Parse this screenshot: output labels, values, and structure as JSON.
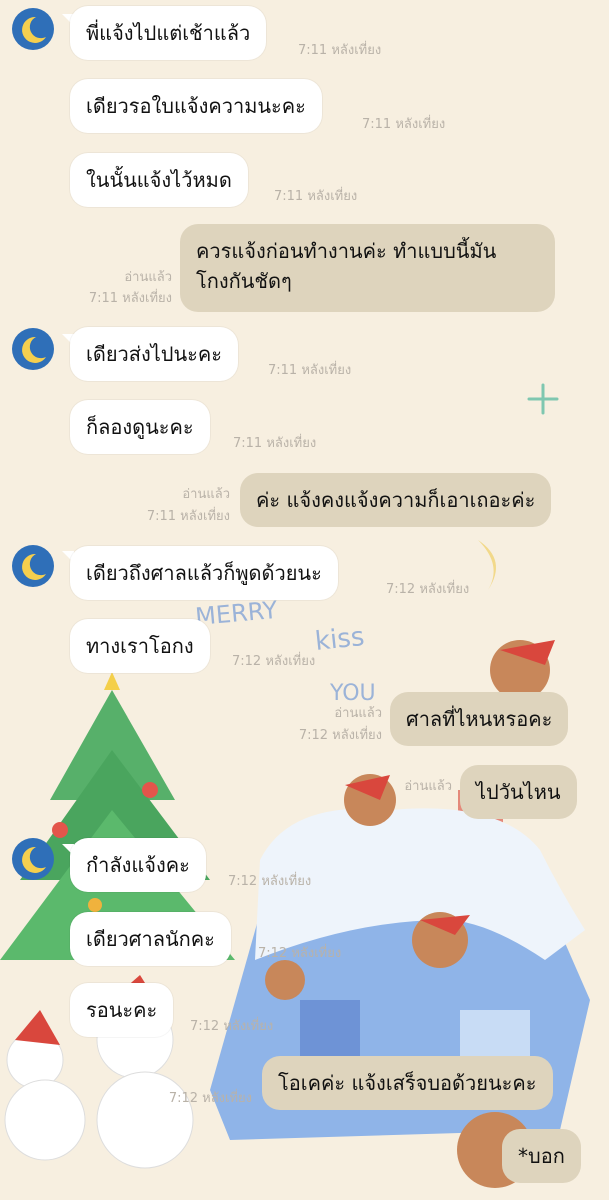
{
  "messages": [
    {
      "text": "พี่แจ้งไปแต่เช้าแล้ว",
      "time": "7:11 หลังเที่ยง"
    },
    {
      "text": "เดียวรอใบแจ้งความนะคะ",
      "time": "7:11 หลังเที่ยง"
    },
    {
      "text": "ในนั้นแจ้งไว้หมด",
      "time": "7:11 หลังเที่ยง"
    },
    {
      "line1": "ควรแจ้งก่อนทำงานค่ะ ทำแบบนี้มัน",
      "line2": "โกงกันชัดๆ",
      "read": "อ่านแล้ว",
      "time": "7:11 หลังเที่ยง"
    },
    {
      "text": "เดียวส่งไปนะคะ",
      "time": "7:11 หลังเที่ยง"
    },
    {
      "text": "ก็ลองดูนะคะ",
      "time": "7:11 หลังเที่ยง"
    },
    {
      "text": "ค่ะ แจ้งคงแจ้งความก็เอาเถอะค่ะ",
      "read": "อ่านแล้ว",
      "time": "7:11 หลังเที่ยง"
    },
    {
      "text": "เดียวถึงศาลแล้วก็พูดด้วยนะ",
      "time": "7:12 หลังเที่ยง"
    },
    {
      "text": "ทางเราโอกง",
      "time": "7:12 หลังเที่ยง"
    },
    {
      "text": "ศาลที่ไหนหรอคะ",
      "read": "อ่านแล้ว",
      "time": "7:12 หลังเที่ยง"
    },
    {
      "text": "ไปวันไหน",
      "read": "อ่านแล้ว"
    },
    {
      "text": "กำลังแจ้งคะ",
      "time": "7:12 หลังเที่ยง"
    },
    {
      "text": "เดียวศาลนักคะ",
      "time": "7:12 หลังเที่ยง"
    },
    {
      "text": "รอนะคะ",
      "time": "7:12 หลังเที่ยง"
    },
    {
      "text": "โอเคค่ะ แจ้งเสร็จบอด้วยนะคะ",
      "time": "7:12 หลังเที่ยง"
    },
    {
      "text": "*บอก"
    }
  ],
  "wallpaper": {
    "scribbles": [
      "MERRY",
      "kiss",
      "YOU"
    ],
    "colors": {
      "background": "#f7efe0",
      "incoming": "#ffffff",
      "outgoing": "#ded4bd",
      "avatar": "#2f6fb8",
      "meta": "#b9b2a8"
    }
  }
}
